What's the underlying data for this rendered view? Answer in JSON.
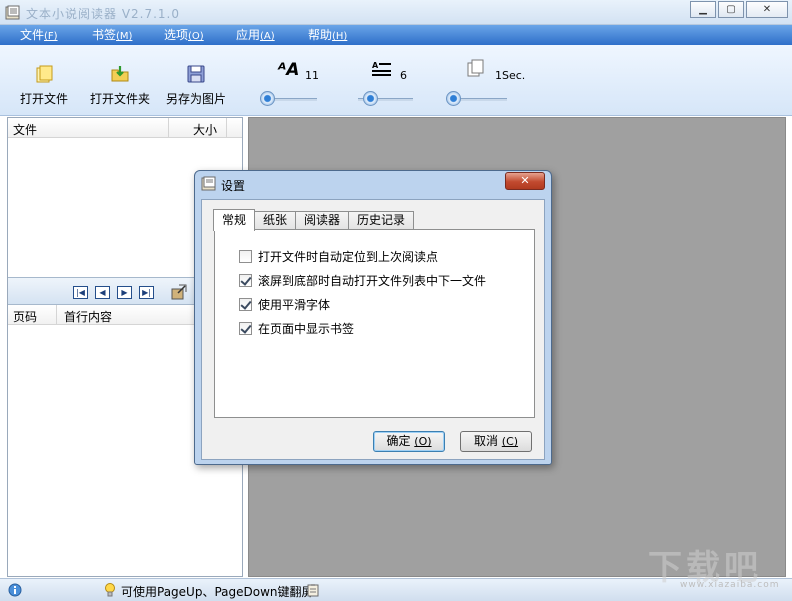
{
  "window": {
    "title": "文本小说阅读器 V2.7.1.0",
    "minimize": "0",
    "maximize": "1",
    "close": "r"
  },
  "menu": [
    {
      "label": "文件",
      "key": "(F)"
    },
    {
      "label": "书签",
      "key": "(M)"
    },
    {
      "label": "选项",
      "key": "(O)"
    },
    {
      "label": "应用",
      "key": "(A)"
    },
    {
      "label": "帮助",
      "key": "(H)"
    }
  ],
  "toolbar": {
    "open_file": "打开文件",
    "open_folder": "打开文件夹",
    "save_as_image": "另存为图片",
    "font_size": {
      "icon": "font-size-icon",
      "value": "11"
    },
    "line_spacing": {
      "icon": "line-spacing-icon",
      "value": "6"
    },
    "page_interval": {
      "icon": "pages-icon",
      "value": "1Sec."
    }
  },
  "file_list": {
    "columns": [
      "文件",
      "大小"
    ]
  },
  "bookmark_list": {
    "columns": [
      "页码",
      "首行内容"
    ]
  },
  "statusbar": {
    "hint": "可使用PageUp、PageDown键翻屏"
  },
  "dialog": {
    "title": "设置",
    "close": "x",
    "tabs": [
      "常规",
      "纸张",
      "阅读器",
      "历史记录"
    ],
    "active_tab": "常规",
    "options": [
      {
        "label": "打开文件时自动定位到上次阅读点",
        "checked": false
      },
      {
        "label": "滚屏到底部时自动打开文件列表中下一文件",
        "checked": true
      },
      {
        "label": "使用平滑字体",
        "checked": true
      },
      {
        "label": "在页面中显示书签",
        "checked": true
      }
    ],
    "ok": "确定",
    "ok_key": "(O)",
    "cancel": "取消",
    "cancel_key": "(C)"
  },
  "watermark": {
    "text": "下载吧",
    "sub": "www.xiazaiba.com"
  },
  "colors": {
    "menubar": "#3a7bd5",
    "viewer_bg": "#a0a0a0",
    "dialog_frame": "#bcd3ee"
  }
}
